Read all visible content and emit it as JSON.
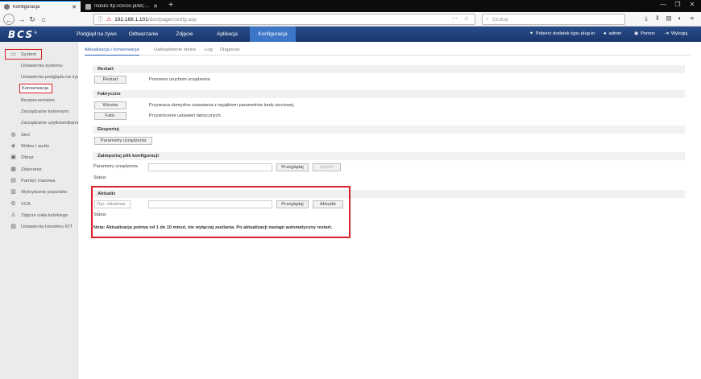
{
  "browser": {
    "tabs": [
      {
        "label": "Konfiguracja",
        "active": true
      },
      {
        "label": "Indeks ftp://chron.pl/BCS/FIRM",
        "active": false
      }
    ],
    "new_tab": "+",
    "window_controls": [
      "—",
      "❐",
      "✕"
    ],
    "url_host": "192.168.1.101",
    "url_path": "/doc/page/config.asp",
    "search_placeholder": "Szukaj"
  },
  "header": {
    "logo": "BCS",
    "nav": [
      "Podgląd na żywo",
      "Odtwarzanie",
      "Zdjęcie",
      "Aplikacja",
      "Konfiguracja"
    ],
    "active_nav": "Konfiguracja",
    "plugin": "Pobierz dodatek typu plug-in",
    "user": "admin",
    "help": "Pomoc",
    "logout": "Wyloguj"
  },
  "sidebar": {
    "system": "System",
    "sub_items": [
      "Ustawienia systemu",
      "Ustawienia podglądu na żywo",
      "Konserwacja",
      "Bezpieczeństwo",
      "Zarządzanie kamerami",
      "Zarządzanie użytkownikami"
    ],
    "selected_sub": "Konserwacja",
    "top_items": [
      {
        "label": "Sieć",
        "icon": "globe-icon"
      },
      {
        "label": "Wideo i audio",
        "icon": "video-audio-icon"
      },
      {
        "label": "Obraz",
        "icon": "image-icon"
      },
      {
        "label": "Zdarzenie",
        "icon": "calendar-icon"
      },
      {
        "label": "Pamięć masowa",
        "icon": "storage-icon"
      },
      {
        "label": "Wykrywanie pojazdów",
        "icon": "vehicle-icon"
      },
      {
        "label": "VCA",
        "icon": "vca-icon"
      },
      {
        "label": "Zdjęcie ciała ludzkiego",
        "icon": "body-icon"
      },
      {
        "label": "Ustawienia transferu IOT",
        "icon": "iot-icon"
      }
    ]
  },
  "subtabs": [
    "Aktualizacja i konserwacja",
    "Uaktualnienie online",
    "Log",
    "Diagnoza"
  ],
  "active_subtab": "Aktualizacja i konserwacja",
  "restart": {
    "title": "Restart",
    "button": "Restart",
    "desc": "Ponowne uruchom urządzenie."
  },
  "factory": {
    "title": "Fabryczne",
    "restore_button": "Wznów",
    "restore_desc": "Przywraca domyślne ustawienia z wyjątkiem parametrów karty sieciowej.",
    "default_button": "Fabr.",
    "default_desc": "Przywrócenie ustawień fabrycznych."
  },
  "export": {
    "title": "Eksportuj",
    "button": "Parametry urządzenia"
  },
  "import": {
    "title": "Zaimportuj plik konfiguracji",
    "label": "Parametry urządzenia",
    "browse": "Przeglądaj",
    "import_button": "Import",
    "status": "Status"
  },
  "update": {
    "title": "Aktualiz",
    "select_value": "Opr. układowe",
    "browse": "Przeglądaj",
    "update_button": "Aktualiz",
    "status": "Status",
    "note": "Nota: Aktualizacja potrwa od 1 do 10 minut, nie wyłączaj zasilania. Po aktualizacji nastąpi automatyczny restart."
  }
}
